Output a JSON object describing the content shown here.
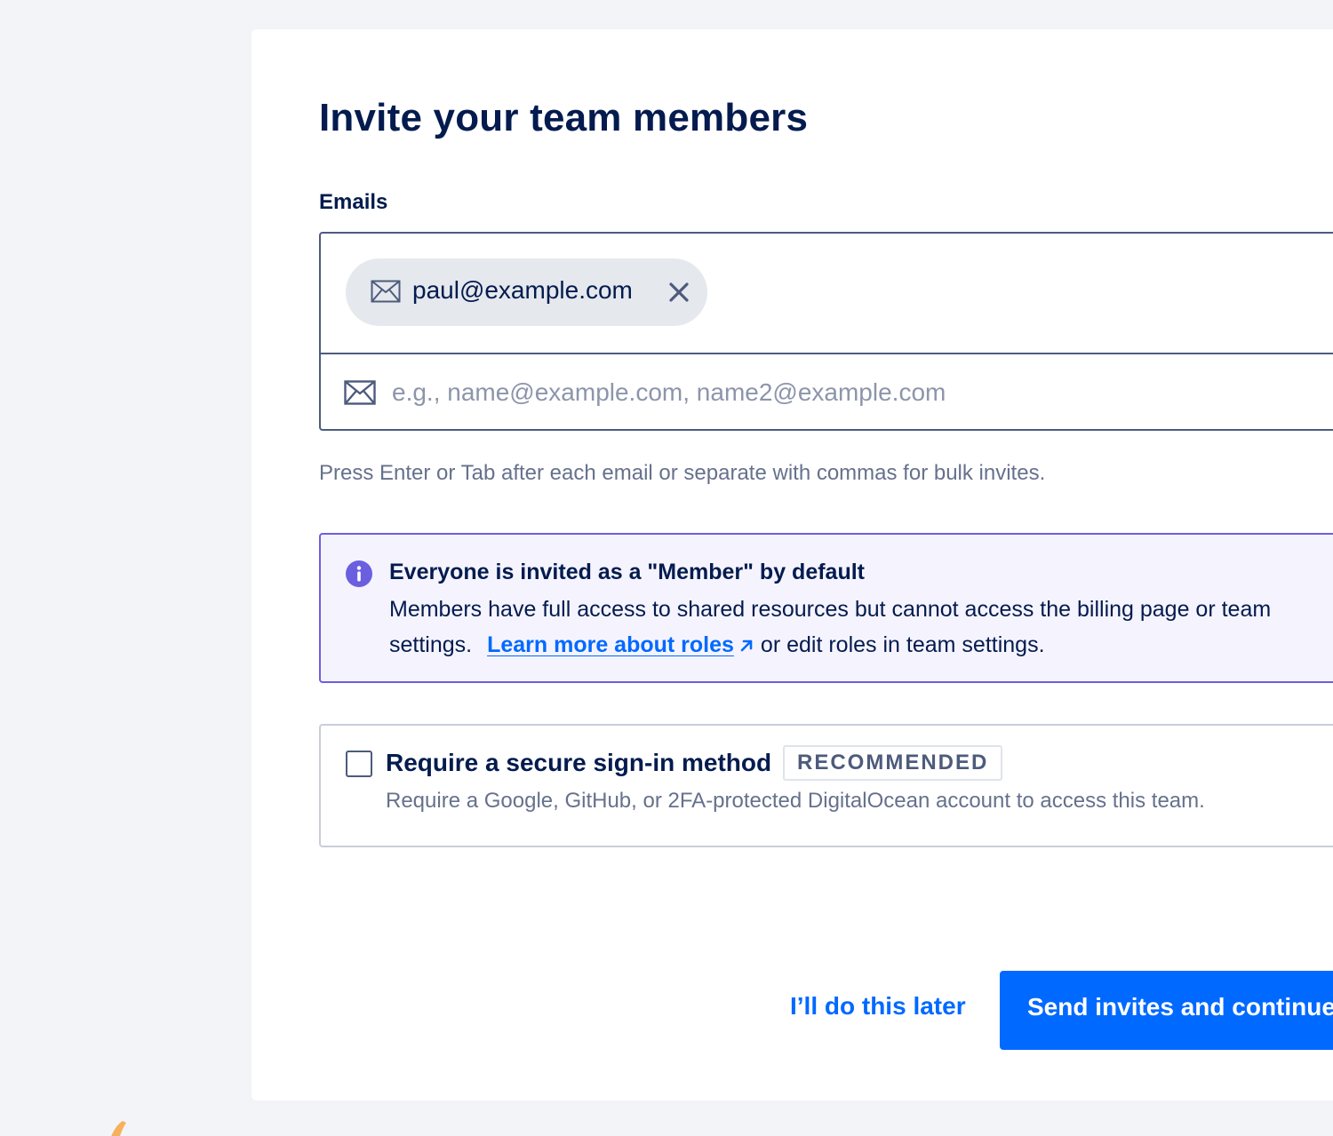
{
  "page": {
    "title": "Invite your team members"
  },
  "emails": {
    "label": "Emails",
    "chips": [
      {
        "value": "paul@example.com"
      }
    ],
    "placeholder": "e.g., name@example.com, name2@example.com",
    "hint": "Press Enter or Tab after each email or separate with commas for bulk invites."
  },
  "info": {
    "title": "Everyone is invited as a \"Member\" by default",
    "body_prefix": "Members have full access to shared resources but cannot access the billing page or team settings.",
    "link_text": "Learn more about roles",
    "body_suffix": "or edit roles in team settings."
  },
  "secure_signin": {
    "label": "Require a secure sign-in method",
    "badge": "RECOMMENDED",
    "description": "Require a Google, GitHub, or 2FA-protected DigitalOcean account to access this team.",
    "checked": false
  },
  "actions": {
    "later_label": "I’ll do this later",
    "primary_label": "Send invites and continue"
  },
  "colors": {
    "primary": "#0069ff",
    "navy": "#031b4e",
    "info_border": "#6b5fe0",
    "info_bg": "#f5f4fe"
  },
  "icons": {
    "chip": "envelope-icon",
    "remove": "close-icon",
    "input": "envelope-icon",
    "info": "info-icon",
    "link": "external-arrow-icon"
  }
}
